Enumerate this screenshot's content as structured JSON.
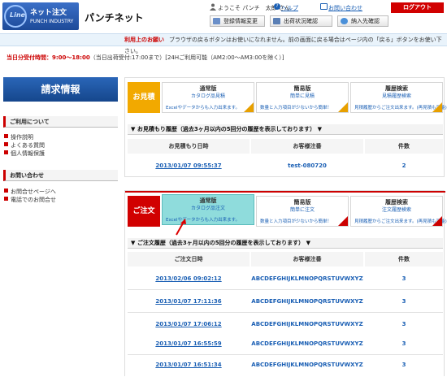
{
  "header": {
    "logo_text1": "ネット注文",
    "logo_text2": "PUNCH INDUSTRY",
    "logo_mark": "Line",
    "site_name": "パンチネット",
    "welcome": "ようこそ パンチ　太郎 さん",
    "help": "ヘルプ",
    "inquiry": "お問い合わせ",
    "logout": "ログアウト",
    "buttons": [
      "登録情報変更",
      "出荷状況確認",
      "納入先確認"
    ]
  },
  "notice": {
    "label": "利用上のお願い",
    "text": "ブラウザの戻るボタンはお使いになれません。前の画面に戻る場合はページ内の「戻る」ボタンをお使い下さい。"
  },
  "hours": {
    "label": "当日分受付時間：9:00～18:00",
    "rest": "（当日出荷受付:17:00まで）[24Hご利用可能（AM2:00～AM3:00を除く）]"
  },
  "sidebar": {
    "title": "請求情報",
    "section1": "ご利用について",
    "links1": [
      "操作説明",
      "よくある質問",
      "個人情報保護"
    ],
    "section2": "お問い合わせ",
    "links2": [
      "お問合せページへ",
      "電話でのお問合せ"
    ]
  },
  "estimate": {
    "tag": "お見積",
    "options": [
      {
        "title": "通常版",
        "sub": "カタログ品見積",
        "desc": "Excelやデータからも入力出来ます。"
      },
      {
        "title": "簡易版",
        "sub": "簡単に見積",
        "desc": "数量と入力項目が少ないから簡単！"
      },
      {
        "title": "履歴検索",
        "sub": "見積履歴検索",
        "desc": "見積履歴からご注文出来ます。(再見積も可能)"
      }
    ],
    "history_title": "▼ お見積もり履歴（過去3ヶ月以内の5回分の履歴を表示しております） ▼",
    "columns": [
      "お見積もり日時",
      "お客様注番",
      "件数"
    ],
    "rows": [
      {
        "date": "2013/01/07 09:55:37",
        "order": "test-080720",
        "count": "2"
      }
    ]
  },
  "order": {
    "tag": "ご注文",
    "options": [
      {
        "title": "通常版",
        "sub": "カタログ品注文",
        "desc": "Excelやデータからも入力出来ます。"
      },
      {
        "title": "簡易版",
        "sub": "簡単に注文",
        "desc": "数量と入力項目が少ないから簡単！"
      },
      {
        "title": "履歴検索",
        "sub": "注文履歴検索",
        "desc": "見積履歴からご注文出来ます。(再見積も可能)"
      }
    ],
    "history_title": "▼ ご注文履歴（過去3ヶ月以内の5回分の履歴を表示しております） ▼",
    "columns": [
      "ご注文日時",
      "お客様注番",
      "件数"
    ],
    "rows": [
      {
        "date": "2013/02/06 09:02:12",
        "order": "ABCDEFGHIJKLMNOPQRSTUVWXYZ",
        "count": "3"
      },
      {
        "date": "2013/01/07 17:11:36",
        "order": "ABCDEFGHIJKLMNOPQRSTUVWXYZ",
        "count": "3"
      },
      {
        "date": "2013/01/07 17:06:12",
        "order": "ABCDEFGHIJKLMNOPQRSTUVWXYZ",
        "count": "3"
      },
      {
        "date": "2013/01/07 16:55:59",
        "order": "ABCDEFGHIJKLMNOPQRSTUVWXYZ",
        "count": "3"
      },
      {
        "date": "2013/01/07 16:51:34",
        "order": "ABCDEFGHIJKLMNOPQRSTUVWXYZ",
        "count": "3"
      }
    ]
  },
  "colors": {
    "accent": "#cc0000",
    "brand": "#1a5fb4",
    "estimate_tag": "#f2a900",
    "order_tag": "#d10000",
    "highlight": "#7fd6d6"
  }
}
